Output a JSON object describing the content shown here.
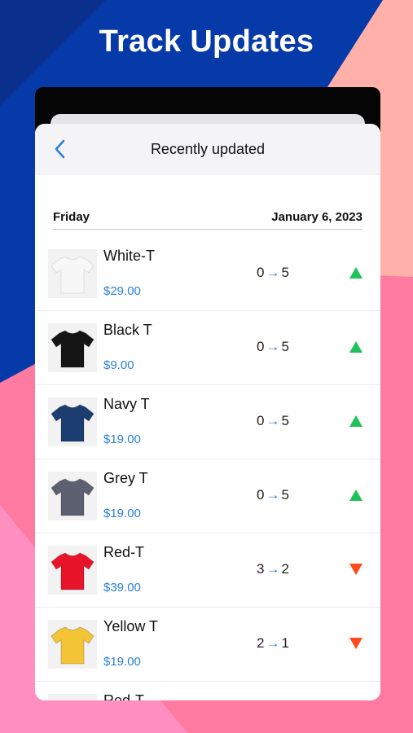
{
  "headline": "Track Updates",
  "colors": {
    "accent_blue": "#2b7fd6",
    "up_green": "#1fc159",
    "down_orange": "#ff4a1c",
    "bg_navy": "#063aa8",
    "bg_pink": "#ff7aa0",
    "bg_peach": "#ffb0a8"
  },
  "navbar": {
    "back_icon": "chevron-left-icon",
    "title": "Recently updated"
  },
  "section": {
    "day": "Friday",
    "date": "January 6, 2023"
  },
  "items": [
    {
      "name": "White-T",
      "price": "$29.00",
      "from": "0",
      "to": "5",
      "trend": "up",
      "shirt_color": "#f7f7f7"
    },
    {
      "name": "Black T",
      "price": "$9.00",
      "from": "0",
      "to": "5",
      "trend": "up",
      "shirt_color": "#151515"
    },
    {
      "name": "Navy T",
      "price": "$19.00",
      "from": "0",
      "to": "5",
      "trend": "up",
      "shirt_color": "#1c3d70"
    },
    {
      "name": "Grey T",
      "price": "$19.00",
      "from": "0",
      "to": "5",
      "trend": "up",
      "shirt_color": "#5d6070"
    },
    {
      "name": "Red-T",
      "price": "$39.00",
      "from": "3",
      "to": "2",
      "trend": "down",
      "shirt_color": "#e8152a"
    },
    {
      "name": "Yellow T",
      "price": "$19.00",
      "from": "2",
      "to": "1",
      "trend": "down",
      "shirt_color": "#f4c437"
    },
    {
      "name": "Red-T",
      "price": "",
      "from": "",
      "to": "",
      "trend": "",
      "shirt_color": "#e8152a"
    }
  ]
}
